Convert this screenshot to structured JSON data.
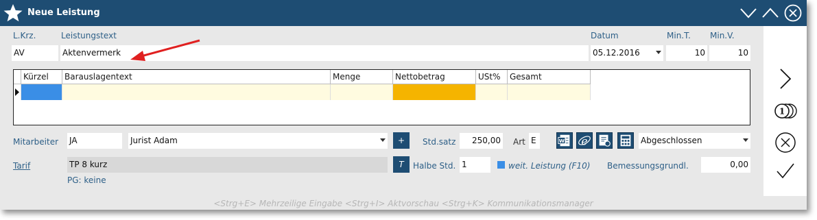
{
  "title": "Neue Leistung",
  "header_labels": {
    "lkrz": "L.Krz.",
    "leistungstext": "Leistungstext",
    "datum": "Datum",
    "mint": "Min.T.",
    "minv": "Min.V."
  },
  "fields": {
    "lkrz": "AV",
    "leistungstext": "Aktenvermerk",
    "datum": "05.12.2016",
    "mint": "10",
    "minv": "10"
  },
  "grid": {
    "columns": [
      "Kürzel",
      "Barauslagentext",
      "Menge",
      "Nettobetrag",
      "USt%",
      "Gesamt"
    ]
  },
  "mitarbeiter": {
    "label": "Mitarbeiter",
    "code": "JA",
    "name": "Jurist Adam",
    "plus": "+"
  },
  "stdsatz": {
    "label": "Std.satz",
    "value": "250,00"
  },
  "art": {
    "label": "Art",
    "value": "E"
  },
  "status": {
    "value": "Abgeschlossen"
  },
  "tarif": {
    "label": "Tarif",
    "value": "TP 8 kurz",
    "btn": "T"
  },
  "halbe": {
    "label": "Halbe Std.",
    "value": "1"
  },
  "weit": {
    "label": "weit. Leistung (F10)"
  },
  "bemessung": {
    "label": "Bemessungsgrundl.",
    "value": "0,00"
  },
  "pg": "PG: keine",
  "footer": "<Strg+E> Mehrzeilige Eingabe <Strg+I> Aktvorschau <Strg+K> Kommunikationsmanager",
  "colors": {
    "accent": "#1e4d73",
    "label": "#2d5f87",
    "yellow": "#fffbe0",
    "orange": "#f5b400",
    "blue": "#3a8ee6",
    "arrow": "#e02020"
  },
  "icons": [
    "star-icon",
    "minimize-chevron-icon",
    "maximize-chevron-icon",
    "close-circle-icon",
    "word-icon",
    "internet-explorer-icon",
    "document-settings-icon",
    "calculator-icon",
    "next-chevron-icon",
    "coins-icon",
    "cancel-circle-icon",
    "checkmark-icon"
  ]
}
